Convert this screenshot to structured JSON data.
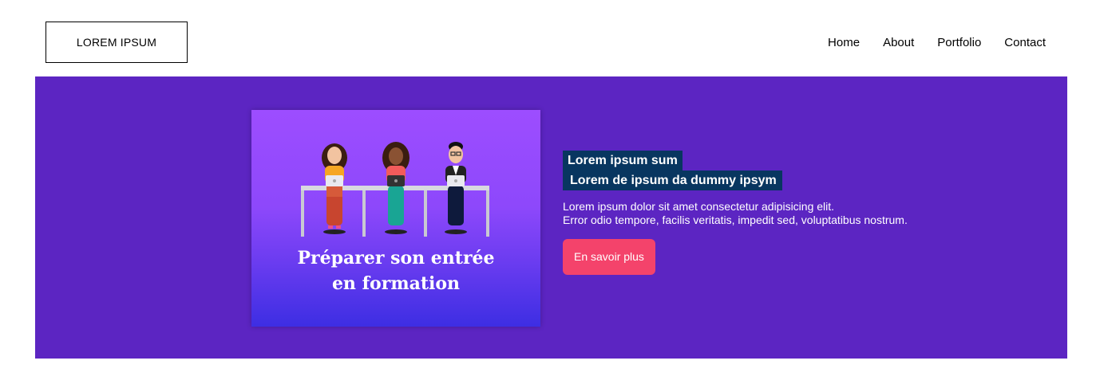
{
  "header": {
    "logo": "LOREM IPSUM",
    "nav": [
      "Home",
      "About",
      "Portfolio",
      "Contact"
    ]
  },
  "hero": {
    "image_caption": "Préparer son entrée\nen formation",
    "heading_line1": "Lorem ipsum sum",
    "heading_line2": "Lorem de ipsum da dummy ipsym",
    "desc_line1": "Lorem ipsum dolor sit amet consectetur adipisicing elit.",
    "desc_line2": "Error odio tempore, facilis veritatis, impedit sed, voluptatibus nostrum.",
    "cta": "En savoir plus"
  },
  "colors": {
    "hero_bg": "#5c25c2",
    "heading_bg": "#083660",
    "cta_bg": "#f4436b"
  }
}
